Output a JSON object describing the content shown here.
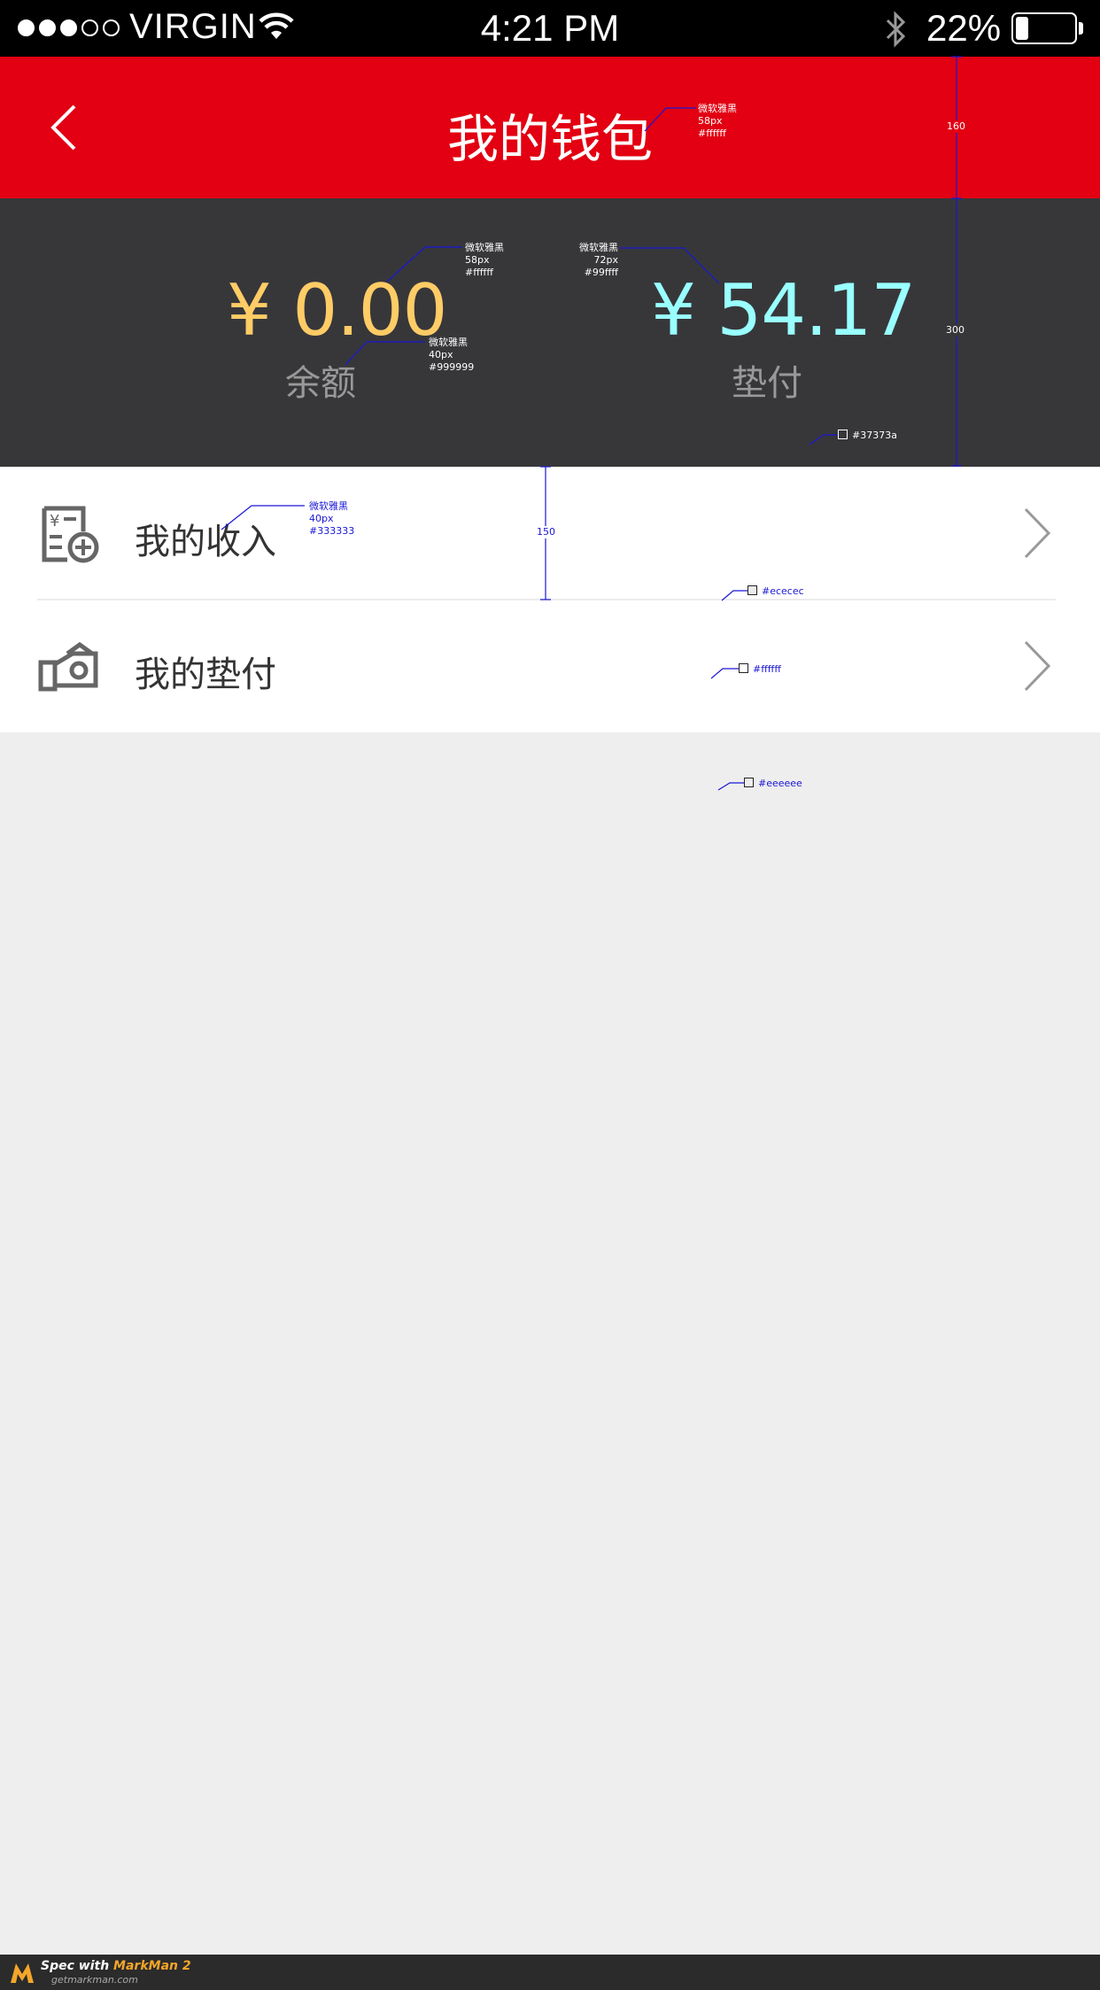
{
  "status_bar": {
    "carrier": "VIRGIN",
    "time": "4:21 PM",
    "battery_percent": "22%",
    "battery_level": 0.22,
    "signal_bars_filled": 3,
    "signal_bars_total": 5
  },
  "nav": {
    "title": "我的钱包",
    "back_icon": "chevron-left-icon",
    "background": "#e20012"
  },
  "summary": {
    "background": "#37373a",
    "balance": {
      "value": "¥ 0.00",
      "label": "余额",
      "color": "#ffcc66"
    },
    "advance": {
      "value": "¥ 54.17",
      "label": "垫付",
      "color": "#99ffff"
    }
  },
  "menu": {
    "items": [
      {
        "label": "我的收入",
        "icon": "income-receipt-icon"
      },
      {
        "label": "我的垫付",
        "icon": "advance-payment-icon"
      }
    ],
    "chevron_icon": "chevron-right-icon",
    "background": "#ffffff",
    "divider_color": "#ececec"
  },
  "page_background": "#eeeeee",
  "annotations": {
    "title_spec": [
      "微软雅黑",
      "58px",
      "#ffffff"
    ],
    "balance_spec": [
      "微软雅黑",
      "58px",
      "#ffffff"
    ],
    "label_spec": [
      "微软雅黑",
      "40px",
      "#999999"
    ],
    "advance_spec": [
      "微软雅黑",
      "72px",
      "#99ffff"
    ],
    "item_spec": [
      "微软雅黑",
      "40px",
      "#333333"
    ],
    "summary_color": "#37373a",
    "divider_color": "#ececec",
    "list_color": "#ffffff",
    "page_color": "#eeeeee",
    "nav_height": "160",
    "summary_height": "300",
    "item_height": "150"
  },
  "footer": {
    "title_prefix": "Spec with",
    "title_brand": "MarkMan 2",
    "url": "getmarkman.com"
  }
}
